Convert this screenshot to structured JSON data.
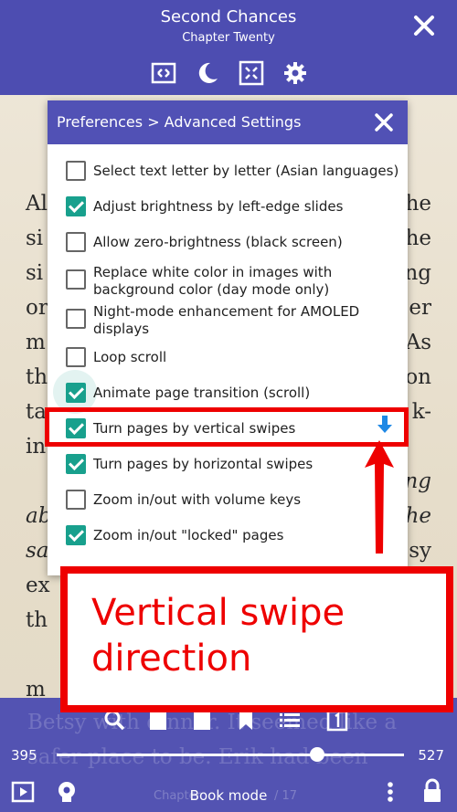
{
  "header": {
    "book_title": "Second Chances",
    "chapter_title": "Chapter Twenty",
    "icons": [
      "expand-icon",
      "moon-icon",
      "fit-screen-icon",
      "gear-icon",
      "close-icon"
    ]
  },
  "dialog": {
    "title": "Preferences >  Advanced Settings",
    "options": [
      {
        "label": "Select text letter by letter (Asian languages)",
        "checked": false
      },
      {
        "label": "Adjust brightness by left-edge slides",
        "checked": true
      },
      {
        "label": "Allow zero-brightness (black screen)",
        "checked": false
      },
      {
        "label": "Replace white color in images with background color (day mode only)",
        "checked": false
      },
      {
        "label": "Night-mode enhancement for AMOLED displays",
        "checked": false
      },
      {
        "label": "Loop scroll",
        "checked": false
      },
      {
        "label": "Animate page transition (scroll)",
        "checked": true
      },
      {
        "label": "Turn pages by vertical swipes",
        "checked": true
      },
      {
        "label": "Turn pages by horizontal swipes",
        "checked": true
      },
      {
        "label": "Zoom in/out with volume keys",
        "checked": false
      },
      {
        "label": "Zoom in/out \"locked\" pages",
        "checked": true
      }
    ],
    "accent_color": "#18a08d",
    "header_color": "#5151b5"
  },
  "book_text": {
    "left_fragments": [
      "Al",
      "si",
      "si",
      "or",
      "m",
      "th",
      "ta",
      "in",
      "ab",
      "sa",
      "ex",
      "th",
      "m"
    ],
    "right_fragments": [
      "he",
      "he",
      "ng",
      "er",
      "As",
      "on",
      "k-",
      "ng",
      "he",
      "sy"
    ],
    "bottom_line_1": "Betsy with dinner. It seemed like a",
    "bottom_line_2": "safer place to be. Erik had been"
  },
  "footer": {
    "page_current": "395",
    "page_total": "527",
    "progress_fraction": 0.75,
    "mode_label": "Book mode",
    "ghost_chapter": "Chapter",
    "ghost_pages": "/ 17"
  },
  "annotation": {
    "callout_text": "Vertical swipe direction",
    "highlight_color": "#ee0000"
  }
}
